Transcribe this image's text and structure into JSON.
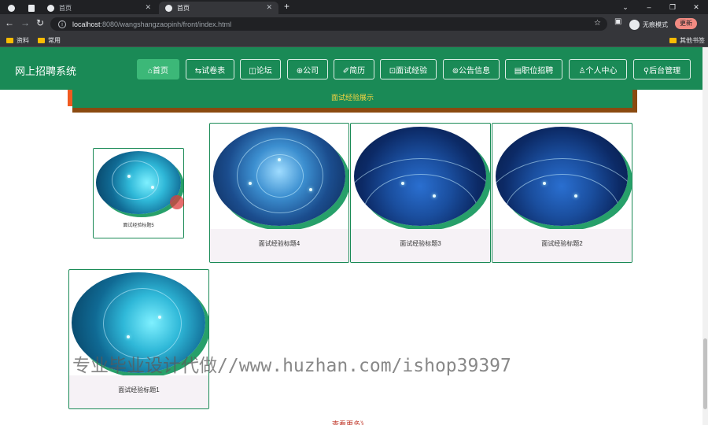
{
  "browser": {
    "tabs": [
      {
        "label": "",
        "state": "inactive"
      },
      {
        "label": "",
        "state": "inactive"
      },
      {
        "label": "首页",
        "state": "inactive"
      },
      {
        "label": "首页",
        "state": "active"
      }
    ],
    "new_tab": "+",
    "url_host": "localhost",
    "url_rest": ":8080/wangshangzaopinh/front/index.html",
    "incognito_label": "无痕模式",
    "update_label": "更新",
    "bookmarks": [
      "资料",
      "常用"
    ],
    "other_bookmarks": "其他书签"
  },
  "site": {
    "title": "网上招聘系统",
    "nav": [
      {
        "label": "⌂首页",
        "active": true
      },
      {
        "label": "⇆试卷表",
        "active": false
      },
      {
        "label": "◫论坛",
        "active": false
      },
      {
        "label": "⊕公司",
        "active": false
      },
      {
        "label": "✐简历",
        "active": false
      },
      {
        "label": "⊡面试经验",
        "active": false
      },
      {
        "label": "⊚公告信息",
        "active": false
      },
      {
        "label": "▤职位招聘",
        "active": false
      },
      {
        "label": "♙个人中心",
        "active": false
      },
      {
        "label": "⚲后台管理",
        "active": false
      }
    ],
    "section_title": "面试经验展示",
    "cards": [
      {
        "caption": "面试经验标题5"
      },
      {
        "caption": "面试经验标题4"
      },
      {
        "caption": "面试经验标题3"
      },
      {
        "caption": "面试经验标题2"
      },
      {
        "caption": "面试经验标题1"
      }
    ],
    "watermark": "专业毕业设计代做//www.huzhan.com/ishop39397",
    "more_link": "查看更多》"
  },
  "colors": {
    "header_green": "#1a8a56",
    "accent_green": "#3cb878",
    "section_brown": "#8a4a10",
    "section_text": "#f5d442",
    "more_link": "#c0392b"
  }
}
